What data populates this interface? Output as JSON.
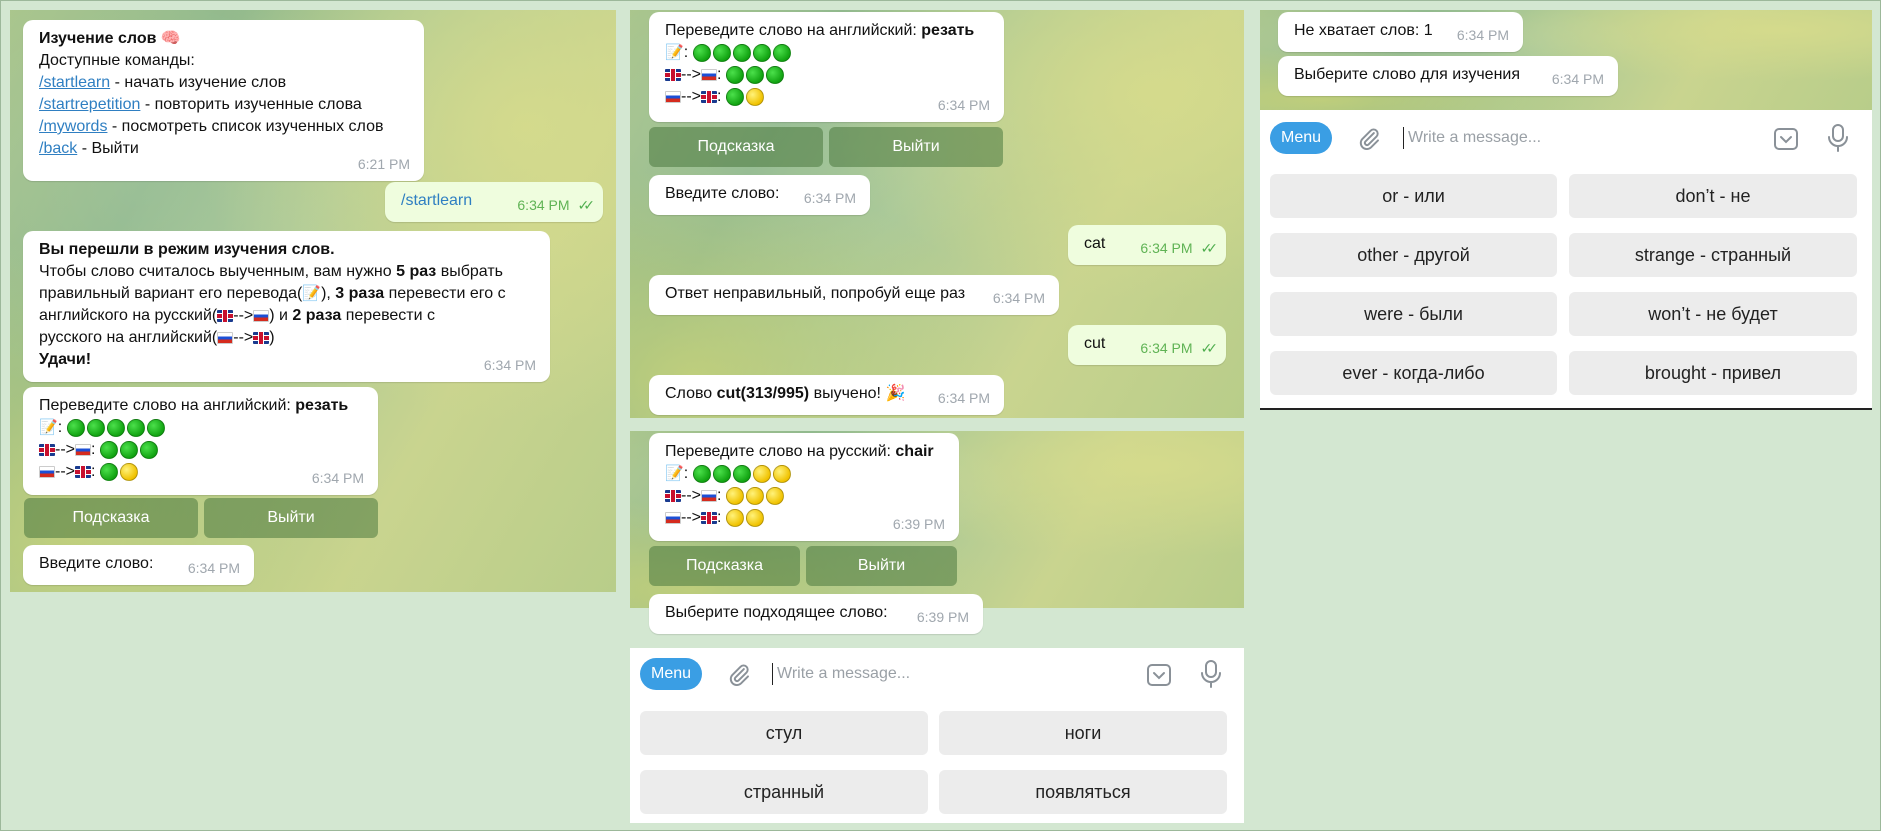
{
  "colors": {
    "accent": "#3a9ee4",
    "outgoing_bubble": "#effdde",
    "link": "#2f7fc2",
    "inline_button": "#5e8a50"
  },
  "left": {
    "welcome": {
      "title": "Изучение слов 🧠",
      "subtitle": "Доступные команды:",
      "cmd1": "/startlearn",
      "cmd1_desc": " - начать изучение слов",
      "cmd2": "/startrepetition",
      "cmd2_desc": " - повторить изученные слова",
      "cmd3": "/mywords",
      "cmd3_desc": " - посмотреть список изученных слов",
      "cmd4": "/back",
      "cmd4_desc": " - Выйти",
      "time": "6:21 PM"
    },
    "out_startlearn": {
      "text": "/startlearn",
      "time": "6:34 PM"
    },
    "mode": {
      "title": "Вы перешли в режим изучения слов.",
      "l1a": "Чтобы слово считалось выученным, вам нужно ",
      "l1b": "5 раз",
      "l1c": " выбрать",
      "l2a": "правильный вариант его перевода(",
      "l2b": "), ",
      "l2c": "3 раза",
      "l2d": " перевести его с",
      "l3a": "английского на русский(",
      "l3b": "-->",
      "l3c": ") и ",
      "l3d": "2 раза",
      "l3e": " перевести с",
      "l4a": "русского на английский(",
      "l4b": "-->",
      "l4c": ")",
      "l5": "Удачи!",
      "time": "6:34 PM"
    },
    "translate": {
      "prompt": "Переведите слово на английский: ",
      "word": "резать",
      "arrow": "-->",
      "colon": ":",
      "time": "6:34 PM"
    },
    "hint_label": "Подсказка",
    "exit_label": "Выйти",
    "enter_word": {
      "text": "Введите слово:",
      "time": "6:34 PM"
    }
  },
  "middle_top": {
    "translate": {
      "prompt": "Переведите слово на английский: ",
      "word": "резать",
      "arrow": "-->",
      "colon": ":",
      "time": "6:34 PM"
    },
    "hint_label": "Подсказка",
    "exit_label": "Выйти",
    "enter_word": {
      "text": "Введите слово:",
      "time": "6:34 PM"
    },
    "out_cat": {
      "text": "cat",
      "time": "6:34 PM"
    },
    "wrong": {
      "text": "Ответ неправильный, попробуй еще раз",
      "time": "6:34 PM"
    },
    "out_cut": {
      "text": "cut",
      "time": "6:34 PM"
    },
    "learned": {
      "a": "Слово ",
      "b": "cut(313/995)",
      "c": " выучено! 🎉",
      "time": "6:34 PM"
    }
  },
  "middle_bottom": {
    "translate": {
      "prompt": "Переведите слово на русский: ",
      "word": "chair",
      "arrow": "-->",
      "colon": ":",
      "time": "6:39 PM"
    },
    "hint_label": "Подсказка",
    "exit_label": "Выйти",
    "choose": {
      "text": "Выберите подходящее слово:",
      "time": "6:39 PM"
    },
    "menu_label": "Menu",
    "input_placeholder": "Write a message...",
    "keyboard": [
      "стул",
      "ноги",
      "странный",
      "появляться"
    ]
  },
  "right": {
    "notenough": {
      "text": "Не хватает слов: 1",
      "time": "6:34 PM"
    },
    "choose": {
      "text": "Выберите слово для изучения",
      "time": "6:34 PM"
    },
    "menu_label": "Menu",
    "input_placeholder": "Write a message...",
    "keyboard": [
      "or - или",
      "don’t - не",
      "other - другой",
      "strange - странный",
      "were - были",
      "won’t - не будет",
      "ever - когда-либо",
      "brought - привел"
    ]
  }
}
